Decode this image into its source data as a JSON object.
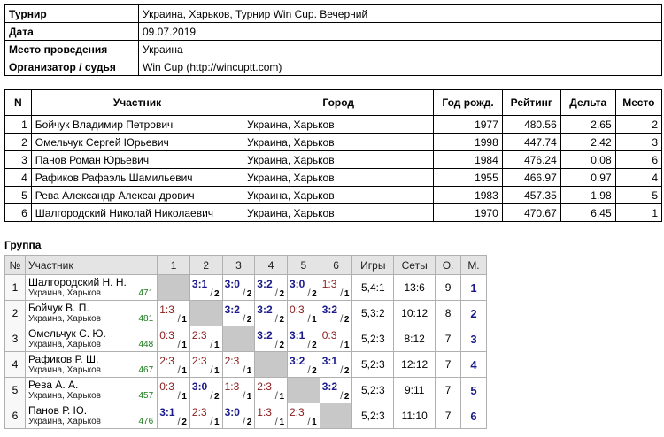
{
  "info": [
    {
      "key": "Турнир",
      "value": "Украина, Харьков, Турнир Win Cup. Вечерний"
    },
    {
      "key": "Дата",
      "value": "09.07.2019"
    },
    {
      "key": "Место проведения",
      "value": "Украина"
    },
    {
      "key": "Организатор / судья",
      "value": "Win Cup (http://wincuptt.com)"
    }
  ],
  "participants": {
    "headers": [
      "N",
      "Участник",
      "Город",
      "Год рожд.",
      "Рейтинг",
      "Дельта",
      "Место"
    ],
    "rows": [
      [
        "1",
        "Бойчук Владимир Петрович",
        "Украина, Харьков",
        "1977",
        "480.56",
        "2.65",
        "2"
      ],
      [
        "2",
        "Омельчук Сергей Юрьевич",
        "Украина, Харьков",
        "1998",
        "447.74",
        "2.42",
        "3"
      ],
      [
        "3",
        "Панов Роман Юрьевич",
        "Украина, Харьков",
        "1984",
        "476.24",
        "0.08",
        "6"
      ],
      [
        "4",
        "Рафиков Рафаэль Шамильевич",
        "Украина, Харьков",
        "1955",
        "466.97",
        "0.97",
        "4"
      ],
      [
        "5",
        "Рева Александр Александрович",
        "Украина, Харьков",
        "1983",
        "457.35",
        "1.98",
        "5"
      ],
      [
        "6",
        "Шалгородский Николай Николаевич",
        "Украина, Харьков",
        "1970",
        "470.67",
        "6.45",
        "1"
      ]
    ]
  },
  "group": {
    "title": "Группа",
    "headers": [
      "№",
      "Участник",
      "1",
      "2",
      "3",
      "4",
      "5",
      "6",
      "Игры",
      "Сеты",
      "О.",
      "М."
    ],
    "rows": [
      {
        "n": "1",
        "name": "Шалгородский Н. Н.",
        "city": "Украина, Харьков",
        "rating": "471",
        "scores": [
          null,
          "3:1",
          "3:0",
          "3:2",
          "3:0",
          "1:3"
        ],
        "pts": [
          null,
          "2",
          "2",
          "2",
          "2",
          "1"
        ],
        "games": "5,4:1",
        "sets": "13:6",
        "points": "9",
        "place": "1"
      },
      {
        "n": "2",
        "name": "Бойчук В. П.",
        "city": "Украина, Харьков",
        "rating": "481",
        "scores": [
          "1:3",
          null,
          "3:2",
          "3:2",
          "0:3",
          "3:2"
        ],
        "pts": [
          "1",
          null,
          "2",
          "2",
          "1",
          "2"
        ],
        "games": "5,3:2",
        "sets": "10:12",
        "points": "8",
        "place": "2"
      },
      {
        "n": "3",
        "name": "Омельчук С. Ю.",
        "city": "Украина, Харьков",
        "rating": "448",
        "scores": [
          "0:3",
          "2:3",
          null,
          "3:2",
          "3:1",
          "0:3"
        ],
        "pts": [
          "1",
          "1",
          null,
          "2",
          "2",
          "1"
        ],
        "games": "5,2:3",
        "sets": "8:12",
        "points": "7",
        "place": "3"
      },
      {
        "n": "4",
        "name": "Рафиков Р. Ш.",
        "city": "Украина, Харьков",
        "rating": "467",
        "scores": [
          "2:3",
          "2:3",
          "2:3",
          null,
          "3:2",
          "3:1"
        ],
        "pts": [
          "1",
          "1",
          "1",
          null,
          "2",
          "2"
        ],
        "games": "5,2:3",
        "sets": "12:12",
        "points": "7",
        "place": "4"
      },
      {
        "n": "5",
        "name": "Рева А. А.",
        "city": "Украина, Харьков",
        "rating": "457",
        "scores": [
          "0:3",
          "3:0",
          "1:3",
          "2:3",
          null,
          "3:2"
        ],
        "pts": [
          "1",
          "2",
          "1",
          "1",
          null,
          "2"
        ],
        "games": "5,2:3",
        "sets": "9:11",
        "points": "7",
        "place": "5"
      },
      {
        "n": "6",
        "name": "Панов Р. Ю.",
        "city": "Украина, Харьков",
        "rating": "476",
        "scores": [
          "3:1",
          "2:3",
          "3:0",
          "1:3",
          "2:3",
          null
        ],
        "pts": [
          "2",
          "1",
          "2",
          "1",
          "1",
          null
        ],
        "games": "5,2:3",
        "sets": "11:10",
        "points": "7",
        "place": "6"
      }
    ]
  }
}
